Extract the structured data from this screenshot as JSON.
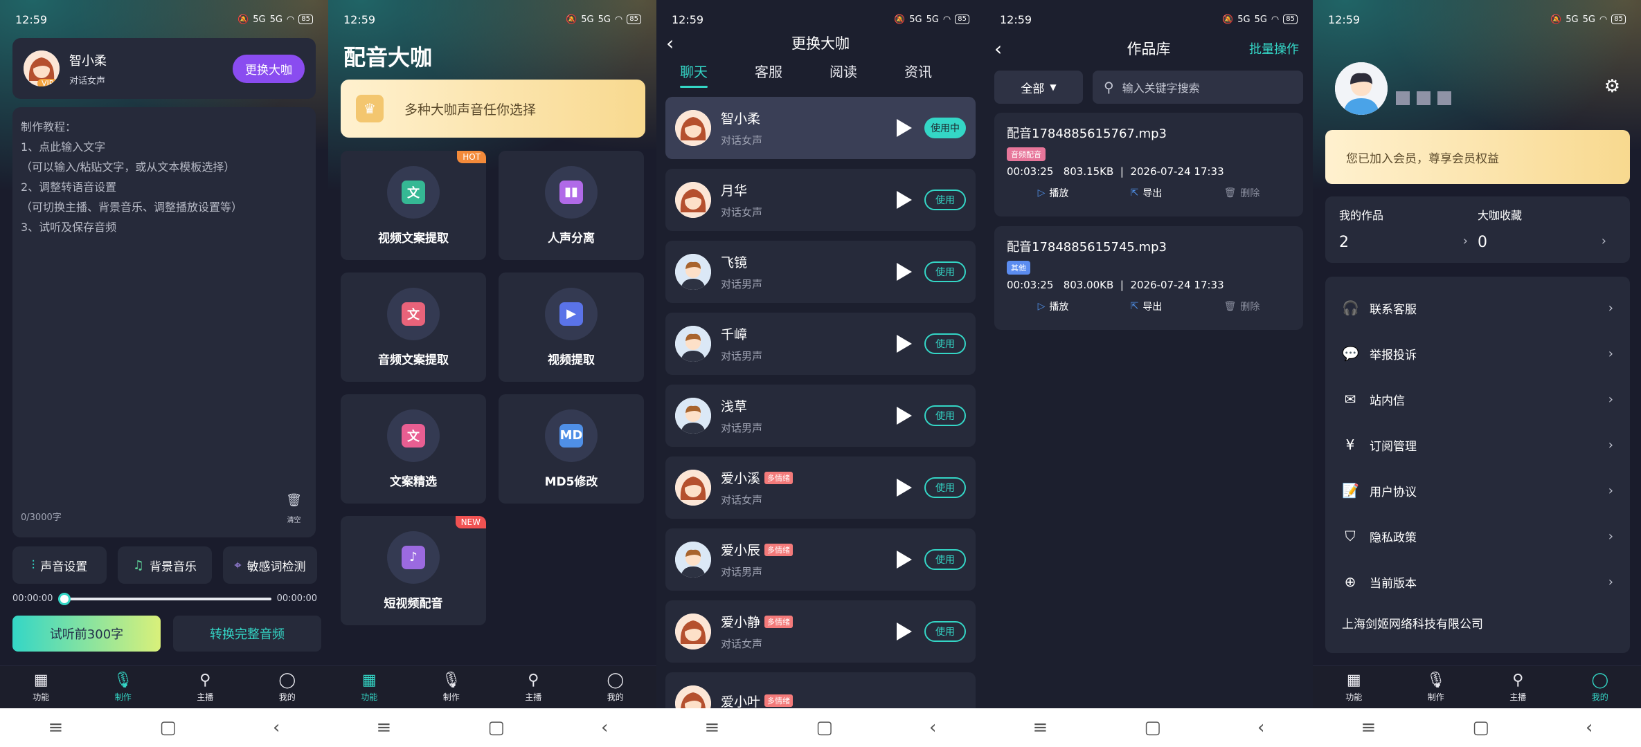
{
  "status": {
    "time": "12:59",
    "battery": "85",
    "net1": "5G",
    "net2": "5G"
  },
  "tabbar": [
    "功能",
    "制作",
    "主播",
    "我的"
  ],
  "s1": {
    "name": "智小柔",
    "sub": "对话女声",
    "vip": "VIP",
    "change": "更换大咖",
    "tutorial": [
      "制作教程：",
      "1、点此输入文字",
      "（可以输入/粘贴文字，或从文本模板选择）",
      "2、调整转语音设置",
      "（可切换主播、背景音乐、调整播放设置等）",
      "3、试听及保存音频"
    ],
    "count": "0/3000字",
    "clear": "清空",
    "tools": [
      "声音设置",
      "背景音乐",
      "敏感词检测"
    ],
    "t_start": "00:00:00",
    "t_end": "00:00:00",
    "try": "试听前300字",
    "full": "转换完整音频"
  },
  "s2": {
    "title": "配音大咖",
    "banner": "多种大咖声音任你选择",
    "cards": [
      {
        "label": "视频文案提取",
        "tag": "HOT",
        "glyph": "文",
        "color": "#35b894"
      },
      {
        "label": "人声分离",
        "tag": "",
        "glyph": "▮▮",
        "color": "#b06ae8"
      },
      {
        "label": "音频文案提取",
        "tag": "",
        "glyph": "文",
        "color": "#e8637a"
      },
      {
        "label": "视频提取",
        "tag": "",
        "glyph": "▶",
        "color": "#5a73e8"
      },
      {
        "label": "文案精选",
        "tag": "",
        "glyph": "文",
        "color": "#e85e92"
      },
      {
        "label": "MD5修改",
        "tag": "",
        "glyph": "MD",
        "color": "#4f8fe6"
      },
      {
        "label": "短视频配音",
        "tag": "NEW",
        "glyph": "♪",
        "color": "#9b6ae0"
      }
    ]
  },
  "s3": {
    "title": "更换大咖",
    "tabs": [
      "聊天",
      "客服",
      "阅读",
      "资讯"
    ],
    "voices": [
      {
        "name": "智小柔",
        "sub": "对话女声",
        "btn": "使用中",
        "tag": "",
        "g": "f"
      },
      {
        "name": "月华",
        "sub": "对话女声",
        "btn": "使用",
        "tag": "",
        "g": "f"
      },
      {
        "name": "飞镜",
        "sub": "对话男声",
        "btn": "使用",
        "tag": "",
        "g": "m"
      },
      {
        "name": "千嶂",
        "sub": "对话男声",
        "btn": "使用",
        "tag": "",
        "g": "m"
      },
      {
        "name": "浅草",
        "sub": "对话男声",
        "btn": "使用",
        "tag": "",
        "g": "m"
      },
      {
        "name": "爱小溪",
        "sub": "对话女声",
        "btn": "使用",
        "tag": "多情绪",
        "g": "f"
      },
      {
        "name": "爱小辰",
        "sub": "对话男声",
        "btn": "使用",
        "tag": "多情绪",
        "g": "m"
      },
      {
        "name": "爱小静",
        "sub": "对话女声",
        "btn": "使用",
        "tag": "多情绪",
        "g": "f"
      },
      {
        "name": "爱小叶",
        "sub": "",
        "btn": "",
        "tag": "多情绪",
        "g": "f"
      }
    ]
  },
  "s4": {
    "title": "作品库",
    "batch": "批量操作",
    "filter": "全部",
    "search_placeholder": "输入关键字搜索",
    "works": [
      {
        "file": "配音1784885615767.mp3",
        "tag": "音频配音",
        "tag_color": "#e7769a",
        "dur": "00:03:25",
        "size": "803.15KB",
        "date": "2026-07-24 17:33"
      },
      {
        "file": "配音1784885615745.mp3",
        "tag": "其他",
        "tag_color": "#5b8cf0",
        "dur": "00:03:25",
        "size": "803.00KB",
        "date": "2026-07-24 17:33"
      }
    ],
    "act_play": "播放",
    "act_export": "导出",
    "act_delete": "删除"
  },
  "s5": {
    "vip_text": "您已加入会员，尊享会员权益",
    "works_label": "我的作品",
    "works_val": "2",
    "fav_label": "大咖收藏",
    "fav_val": "0",
    "menu": [
      "联系客服",
      "举报投诉",
      "站内信",
      "订阅管理",
      "用户协议",
      "隐私政策",
      "当前版本"
    ],
    "company": "上海剑姬网络科技有限公司"
  },
  "icons": [
    "feature-grid-icon",
    "mic-icon",
    "search-person-icon",
    "user-icon",
    "play-icon",
    "export-icon",
    "trash-icon",
    "gear-icon",
    "chevron-right-icon",
    "back-icon"
  ],
  "colors": {
    "accent": "#34d6c6",
    "bg": "#1a1c2c",
    "card": "#262a3a",
    "purple": "#8a4cf0"
  }
}
